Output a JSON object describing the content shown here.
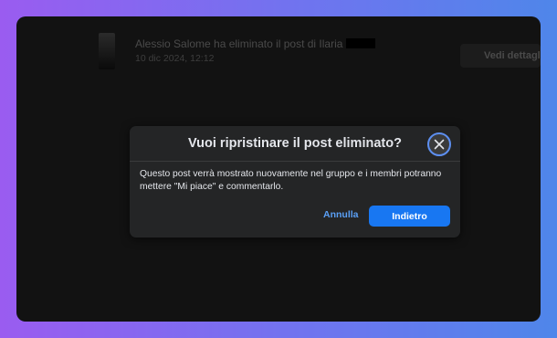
{
  "activity": {
    "text": "Alessio Salome ha eliminato il post di Ilaria",
    "date": "10 dic 2024, 12:12",
    "details_label": "Vedi dettagli"
  },
  "dialog": {
    "title": "Vuoi ripristinare il post eliminato?",
    "body": "Questo post verrà mostrato nuovamente nel gruppo e i membri potranno mettere \"Mi piace\" e commentarlo.",
    "cancel_label": "Annulla",
    "confirm_label": "Indietro"
  },
  "icons": {
    "close": "close-icon"
  },
  "colors": {
    "primary": "#1877f2",
    "link": "#5aa0f6",
    "dialog_bg": "#242526",
    "focus_ring": "#5d8ff0"
  }
}
